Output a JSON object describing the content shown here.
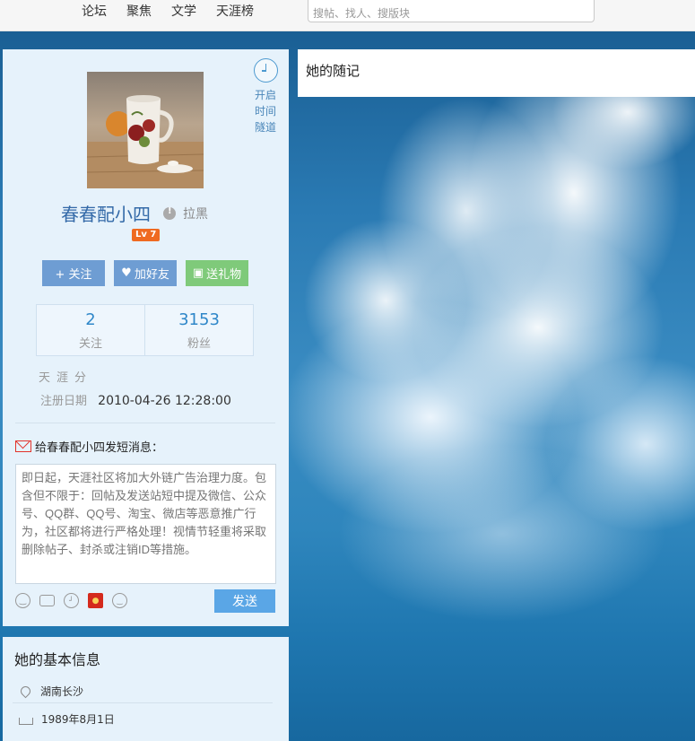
{
  "topbar": {
    "nav": [
      "论坛",
      "聚焦",
      "文学",
      "天涯榜"
    ],
    "search_placeholder": "搜帖、找人、搜版块"
  },
  "profile": {
    "time_tunnel": [
      "开启",
      "时间",
      "隧道"
    ],
    "username": "春春配小四",
    "block_label": "拉黑",
    "level": "Lv 7",
    "actions": {
      "follow": "+ 关注",
      "add_friend": "加好友",
      "send_gift": "送礼物"
    },
    "stats": [
      {
        "value": "2",
        "label": "关注"
      },
      {
        "value": "3153",
        "label": "粉丝"
      }
    ],
    "tianya_score_label": "天涯分",
    "register_label": "注册日期",
    "register_date": "2010-04-26 12:28:00"
  },
  "message": {
    "title": "给春春配小四发短消息：",
    "placeholder": "即日起，天涯社区将加大外链广告治理力度。包含但不限于：回帖及发送站短中提及微信、公众号、QQ群、QQ号、淘宝、微店等恶意推广行为，社区都将进行严格处理！视情节轻重将采取删除帖子、封杀或注销ID等措施。",
    "send_label": "发送",
    "toolbar_icons": [
      "smiley-icon",
      "camera-icon",
      "clock-icon",
      "red-envelope-icon",
      "monkey-icon"
    ]
  },
  "basic_info": {
    "title": "她的基本信息",
    "location": "湖南长沙",
    "birthday": "1989年8月1日"
  },
  "notes": {
    "title": "她的随记"
  },
  "colors": {
    "panel_bg": "#e6f2fb",
    "primary_blue": "#6e9dd3",
    "gift_green": "#7fca7a",
    "level_orange": "#ef6a21",
    "send_blue": "#5aa6e6",
    "link_blue": "#346aa8"
  }
}
